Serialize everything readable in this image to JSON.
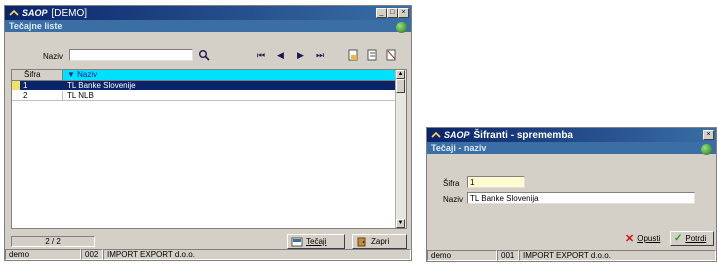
{
  "main_window": {
    "logo": "SAOP",
    "title": "[DEMO]",
    "subtitle": "Tečajne liste",
    "filter_label": "Naziv",
    "filter_value": "",
    "columns": [
      "Šifra",
      "Naziv"
    ],
    "rows": [
      {
        "sifra": "1",
        "naziv": "TL Banke Slovenije",
        "selected": true
      },
      {
        "sifra": "2",
        "naziv": "TL NLB",
        "selected": false
      }
    ],
    "record_counter": "2 / 2",
    "buttons": {
      "tecaji": "Tečaji",
      "zapri": "Zapri"
    },
    "status": {
      "user": "demo",
      "code": "002",
      "company": "IMPORT EXPORT d.o.o."
    }
  },
  "dialog": {
    "logo": "SAOP",
    "title": "Šifranti - sprememba",
    "subtitle": "Tečaji - naziv",
    "sifra_label": "Šifra",
    "sifra_value": "1",
    "naziv_label": "Naziv",
    "naziv_value": "TL Banke Slovenija",
    "buttons": {
      "opusti": "Opusti",
      "potrdi": "Potrdi"
    },
    "status": {
      "user": "demo",
      "code": "001",
      "company": "IMPORT EXPORT d.o.o."
    }
  },
  "colors": {
    "title": "#0a246a",
    "subtitle": "#3a6ea5",
    "selected_row": "#0a246a",
    "header": "#00e0ff",
    "cancel": "#d01010",
    "ok": "#2a9a2a"
  }
}
